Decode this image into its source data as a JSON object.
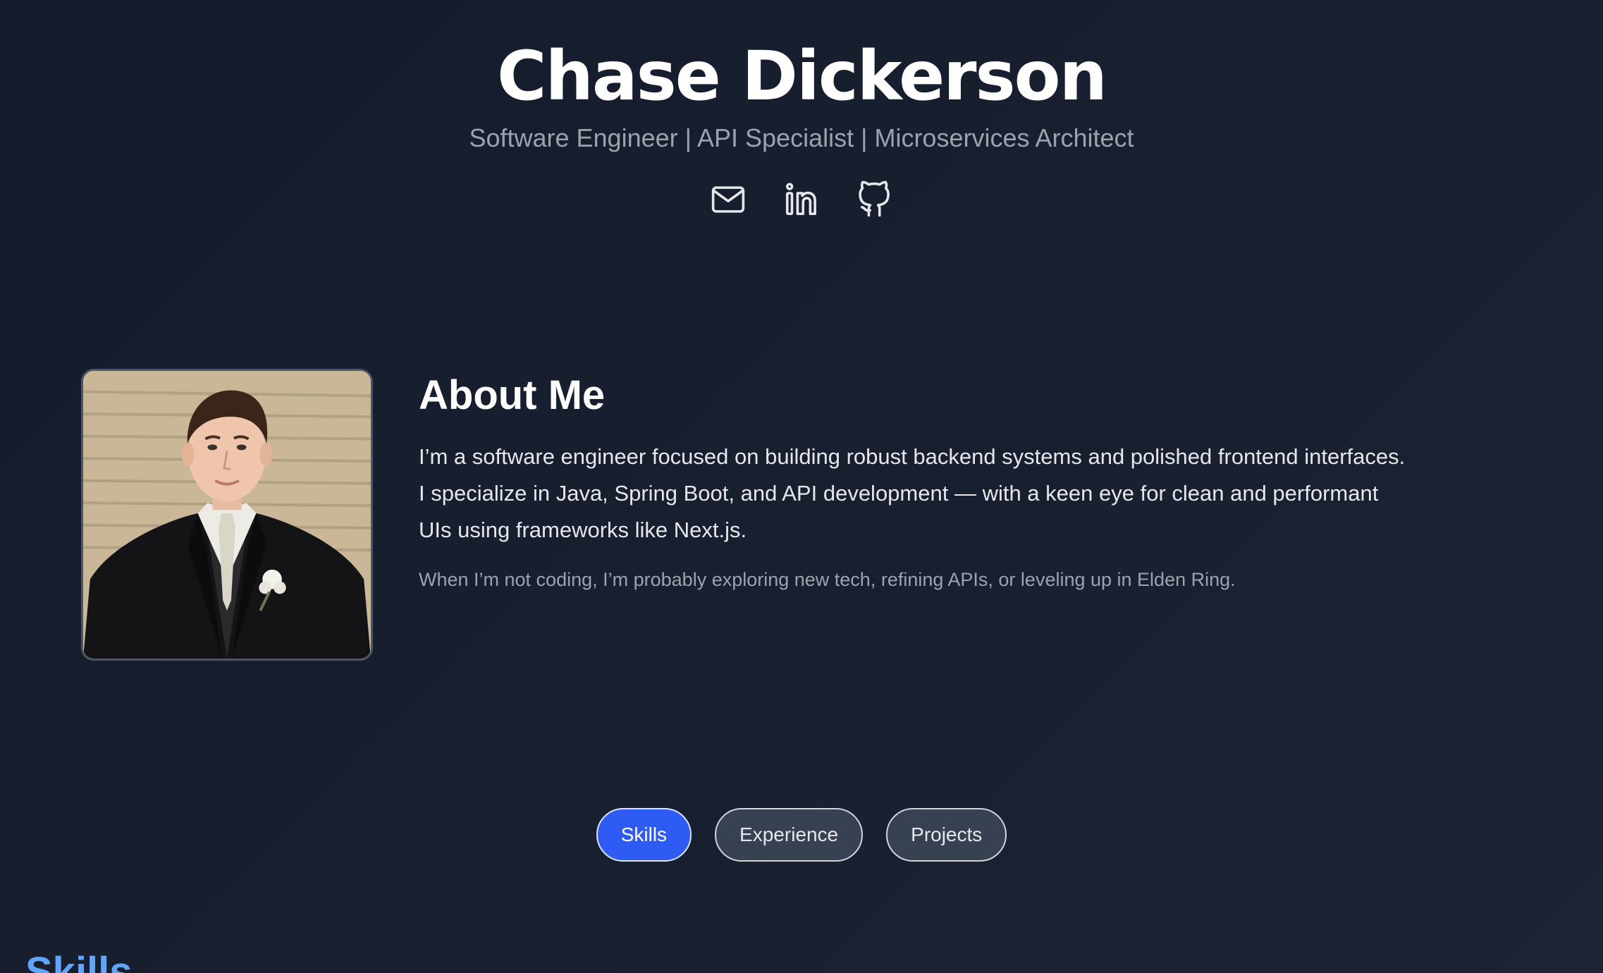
{
  "header": {
    "name": "Chase Dickerson",
    "tagline": "Software Engineer | API Specialist | Microservices Architect",
    "socials": [
      {
        "name": "email",
        "icon": "mail-icon"
      },
      {
        "name": "linkedin",
        "icon": "linkedin-icon"
      },
      {
        "name": "github",
        "icon": "github-icon"
      }
    ]
  },
  "about": {
    "title": "About Me",
    "body": "I’m a software engineer focused on building robust backend systems and polished frontend interfaces. I specialize in Java, Spring Boot, and API development — with a keen eye for clean and performant UIs using frameworks like Next.js.",
    "note": "When I’m not coding, I’m probably exploring new tech, refining APIs, or leveling up in Elden Ring."
  },
  "tabs": [
    {
      "label": "Skills",
      "active": true
    },
    {
      "label": "Experience",
      "active": false
    },
    {
      "label": "Projects",
      "active": false
    }
  ],
  "section": {
    "title": "Skills"
  },
  "colors": {
    "background": "#161c2b",
    "accent": "#2f5bf5",
    "section_title": "#60a5fa",
    "muted_text": "#9ca3af"
  }
}
